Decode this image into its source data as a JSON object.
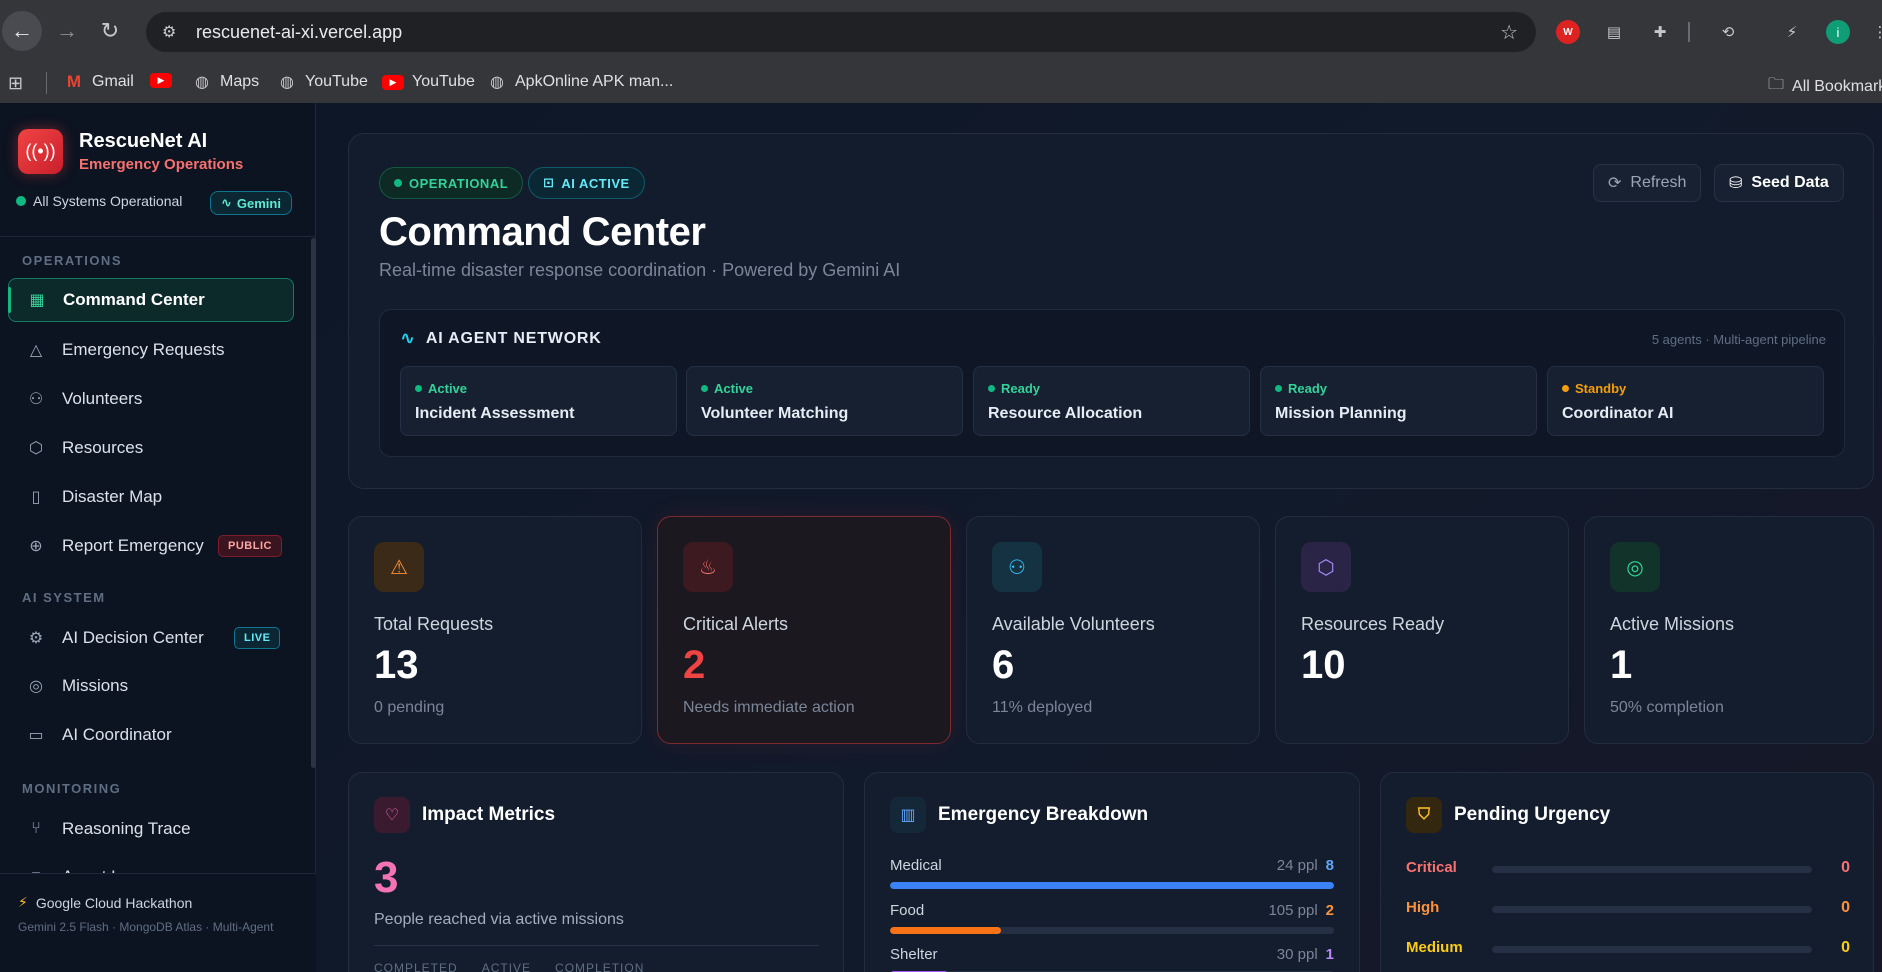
{
  "browser": {
    "url": "rescuenet-ai-xi.vercel.app",
    "bookmarks": [
      {
        "label": "Gmail",
        "icon": "gmail-icon"
      },
      {
        "label": "",
        "icon": "youtube-icon"
      },
      {
        "label": "Maps",
        "icon": "globe-icon"
      },
      {
        "label": "YouTube",
        "icon": "globe-icon"
      },
      {
        "label": "YouTube",
        "icon": "youtube-icon"
      },
      {
        "label": "ApkOnline APK man...",
        "icon": "globe-icon"
      }
    ],
    "all_bookmarks": "All Bookmarks",
    "ext_wv": "W",
    "avatar_letter": "i"
  },
  "sidebar": {
    "brand_name": "RescueNet AI",
    "brand_sub": "Emergency Operations",
    "status": "All Systems Operational",
    "gemini_pill": "Gemini",
    "sections": {
      "operations": "OPERATIONS",
      "ai_system": "AI SYSTEM",
      "monitoring": "MONITORING"
    },
    "items": [
      {
        "label": "Command Center"
      },
      {
        "label": "Emergency Requests"
      },
      {
        "label": "Volunteers"
      },
      {
        "label": "Resources"
      },
      {
        "label": "Disaster Map"
      },
      {
        "label": "Report Emergency",
        "tag": "PUBLIC"
      },
      {
        "label": "AI Decision Center",
        "tag": "LIVE"
      },
      {
        "label": "Missions"
      },
      {
        "label": "AI Coordinator"
      },
      {
        "label": "Reasoning Trace"
      },
      {
        "label": "Agent Logs"
      }
    ],
    "footer_title": "Google Cloud Hackathon",
    "footer_sub": "Gemini 2.5 Flash · MongoDB Atlas · Multi-Agent"
  },
  "hero": {
    "badge_operational": "OPERATIONAL",
    "badge_ai": "AI ACTIVE",
    "title": "Command Center",
    "subtitle": "Real-time disaster response coordination · Powered by Gemini AI",
    "refresh_label": "Refresh",
    "seed_label": "Seed Data",
    "agents_title": "AI AGENT NETWORK",
    "agents_meta": "5 agents · Multi-agent pipeline",
    "agents": [
      {
        "status": "Active",
        "name": "Incident Assessment",
        "color": "#34d399"
      },
      {
        "status": "Active",
        "name": "Volunteer Matching",
        "color": "#34d399"
      },
      {
        "status": "Ready",
        "name": "Resource Allocation",
        "color": "#34d399"
      },
      {
        "status": "Ready",
        "name": "Mission Planning",
        "color": "#34d399"
      },
      {
        "status": "Standby",
        "name": "Coordinator AI",
        "color": "#f59e0b"
      }
    ]
  },
  "stats": [
    {
      "label": "Total Requests",
      "value": "13",
      "sub": "0 pending"
    },
    {
      "label": "Critical Alerts",
      "value": "2",
      "sub": "Needs immediate action"
    },
    {
      "label": "Available Volunteers",
      "value": "6",
      "sub": "11% deployed"
    },
    {
      "label": "Resources Ready",
      "value": "10",
      "sub": ""
    },
    {
      "label": "Active Missions",
      "value": "1",
      "sub": "50% completion"
    }
  ],
  "impact": {
    "title": "Impact Metrics",
    "value": "3",
    "label": "People reached via active missions",
    "cols": [
      "COMPLETED",
      "ACTIVE",
      "COMPLETION"
    ]
  },
  "breakdown": {
    "title": "Emergency Breakdown",
    "rows": [
      {
        "label": "Medical",
        "ppl": "24 ppl",
        "count": "8",
        "fill": 1.0,
        "color": "#3b82f6"
      },
      {
        "label": "Food",
        "ppl": "105 ppl",
        "count": "2",
        "fill": 0.25,
        "color": "#f97316"
      },
      {
        "label": "Shelter",
        "ppl": "30 ppl",
        "count": "1",
        "fill": 0.13,
        "color": "#a855f7"
      }
    ]
  },
  "urgency": {
    "title": "Pending Urgency",
    "rows": [
      {
        "label": "Critical",
        "value": "0",
        "color": "#f87171",
        "fill": 0
      },
      {
        "label": "High",
        "value": "0",
        "color": "#fb923c",
        "fill": 0
      },
      {
        "label": "Medium",
        "value": "0",
        "color": "#facc15",
        "fill": 0
      }
    ]
  }
}
